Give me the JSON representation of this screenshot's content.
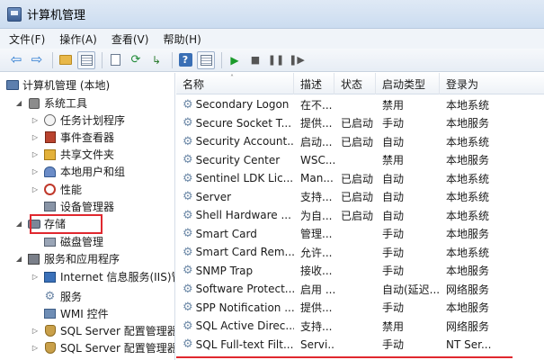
{
  "window": {
    "title": "计算机管理"
  },
  "menu": [
    "文件(F)",
    "操作(A)",
    "查看(V)",
    "帮助(H)"
  ],
  "toolbar": {
    "icons": [
      "back-arrow-icon",
      "forward-arrow-icon",
      "up-folder-icon",
      "show-hide-tree-icon",
      "properties-icon",
      "refresh-icon",
      "export-list-icon",
      "help-icon",
      "show-hide-action-pane-icon",
      "start-service-icon",
      "stop-service-icon",
      "pause-service-icon",
      "restart-service-icon"
    ]
  },
  "tree": {
    "root": "计算机管理 (本地)",
    "system_tools": "系统工具",
    "task_scheduler": "任务计划程序",
    "event_viewer": "事件查看器",
    "shared_folders": "共享文件夹",
    "local_users": "本地用户和组",
    "performance": "性能",
    "device_manager": "设备管理器",
    "storage": "存储",
    "disk_management": "磁盘管理",
    "services_apps": "服务和应用程序",
    "iis": "Internet 信息服务(IIS)管",
    "services": "服务",
    "wmi": "WMI 控件",
    "sql1": "SQL Server 配置管理器",
    "sql2": "SQL Server 配置管理器"
  },
  "list": {
    "columns": [
      "名称",
      "描述",
      "状态",
      "启动类型",
      "登录为"
    ],
    "rows": [
      {
        "name": "Secondary Logon",
        "desc": "在不...",
        "status": "",
        "startup": "禁用",
        "logon": "本地系统"
      },
      {
        "name": "Secure Socket T...",
        "desc": "提供...",
        "status": "已启动",
        "startup": "手动",
        "logon": "本地服务"
      },
      {
        "name": "Security Account...",
        "desc": "启动...",
        "status": "已启动",
        "startup": "自动",
        "logon": "本地系统"
      },
      {
        "name": "Security Center",
        "desc": "WSC...",
        "status": "",
        "startup": "禁用",
        "logon": "本地服务"
      },
      {
        "name": "Sentinel LDK Lic...",
        "desc": "Man...",
        "status": "已启动",
        "startup": "自动",
        "logon": "本地系统"
      },
      {
        "name": "Server",
        "desc": "支持...",
        "status": "已启动",
        "startup": "自动",
        "logon": "本地系统"
      },
      {
        "name": "Shell Hardware ...",
        "desc": "为自...",
        "status": "已启动",
        "startup": "自动",
        "logon": "本地系统"
      },
      {
        "name": "Smart Card",
        "desc": "管理...",
        "status": "",
        "startup": "手动",
        "logon": "本地服务"
      },
      {
        "name": "Smart Card Rem...",
        "desc": "允许...",
        "status": "",
        "startup": "手动",
        "logon": "本地系统"
      },
      {
        "name": "SNMP Trap",
        "desc": "接收...",
        "status": "",
        "startup": "手动",
        "logon": "本地服务"
      },
      {
        "name": "Software Protect...",
        "desc": "启用 ...",
        "status": "",
        "startup": "自动(延迟...",
        "logon": "网络服务"
      },
      {
        "name": "SPP Notification ...",
        "desc": "提供...",
        "status": "",
        "startup": "手动",
        "logon": "本地服务"
      },
      {
        "name": "SQL Active Direc...",
        "desc": "支持...",
        "status": "",
        "startup": "禁用",
        "logon": "网络服务"
      },
      {
        "name": "SQL Full-text Filt...",
        "desc": "Servi...",
        "status": "",
        "startup": "手动",
        "logon": "NT Ser..."
      }
    ]
  },
  "colors": {
    "highlight": "#e0282f"
  }
}
